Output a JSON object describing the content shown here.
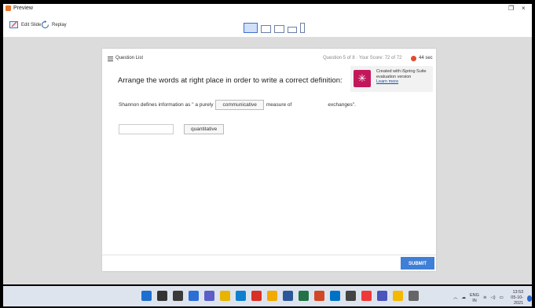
{
  "window": {
    "title": "Preview",
    "minimize_icon": "maximize-icon",
    "close_glyph": "×",
    "restore_glyph": "❐"
  },
  "toolbar": {
    "edit_slide_label": "Edit Slide",
    "replay_label": "Replay",
    "devices": [
      "desktop-icon",
      "tablet-landscape-icon",
      "tablet-portrait-icon",
      "phone-landscape-icon",
      "phone-portrait-icon"
    ]
  },
  "quiz": {
    "question_list_label": "Question List",
    "question_info": "Question 5 of 8  ·  Your Score: 72 of 72",
    "timer": "44 sec",
    "prompt": "Arrange the words at right place in order to write a correct definition:",
    "sentence": {
      "before": "Shannon defines information as \" a purely",
      "chip1": "communicative",
      "middle": "measure of",
      "after": "exchanges\"."
    },
    "chip2": "quantitative",
    "submit_label": "SUBMIT"
  },
  "promo": {
    "line1": "Created with iSpring Suite",
    "line2": "evaluation version",
    "link": "Learn more"
  },
  "taskbar": {
    "lang_top": "ENG",
    "lang_bottom": "IN",
    "time": "13:53",
    "date": "05-10-2021",
    "apps": [
      {
        "name": "windows-start-icon",
        "color": "#1f6fd1"
      },
      {
        "name": "search-icon",
        "color": "#333333"
      },
      {
        "name": "task-view-icon",
        "color": "#3a3a3a"
      },
      {
        "name": "widgets-icon",
        "color": "#2b6fd6"
      },
      {
        "name": "chat-icon",
        "color": "#5b5fc7"
      },
      {
        "name": "file-explorer-icon",
        "color": "#e8b400"
      },
      {
        "name": "edge-icon",
        "color": "#0f7fcf"
      },
      {
        "name": "chrome-icon",
        "color": "#d93025"
      },
      {
        "name": "file-manager-icon",
        "color": "#f2a900"
      },
      {
        "name": "word-icon",
        "color": "#2b579a"
      },
      {
        "name": "excel-icon",
        "color": "#217346"
      },
      {
        "name": "powerpoint-icon",
        "color": "#d24726"
      },
      {
        "name": "outlook-icon",
        "color": "#0072c6"
      },
      {
        "name": "media-icon",
        "color": "#444444"
      },
      {
        "name": "vivaldi-icon",
        "color": "#ef3939"
      },
      {
        "name": "teams-icon",
        "color": "#4b53bc"
      },
      {
        "name": "notes-icon",
        "color": "#f5b800"
      },
      {
        "name": "settings-icon",
        "color": "#666666"
      }
    ]
  }
}
